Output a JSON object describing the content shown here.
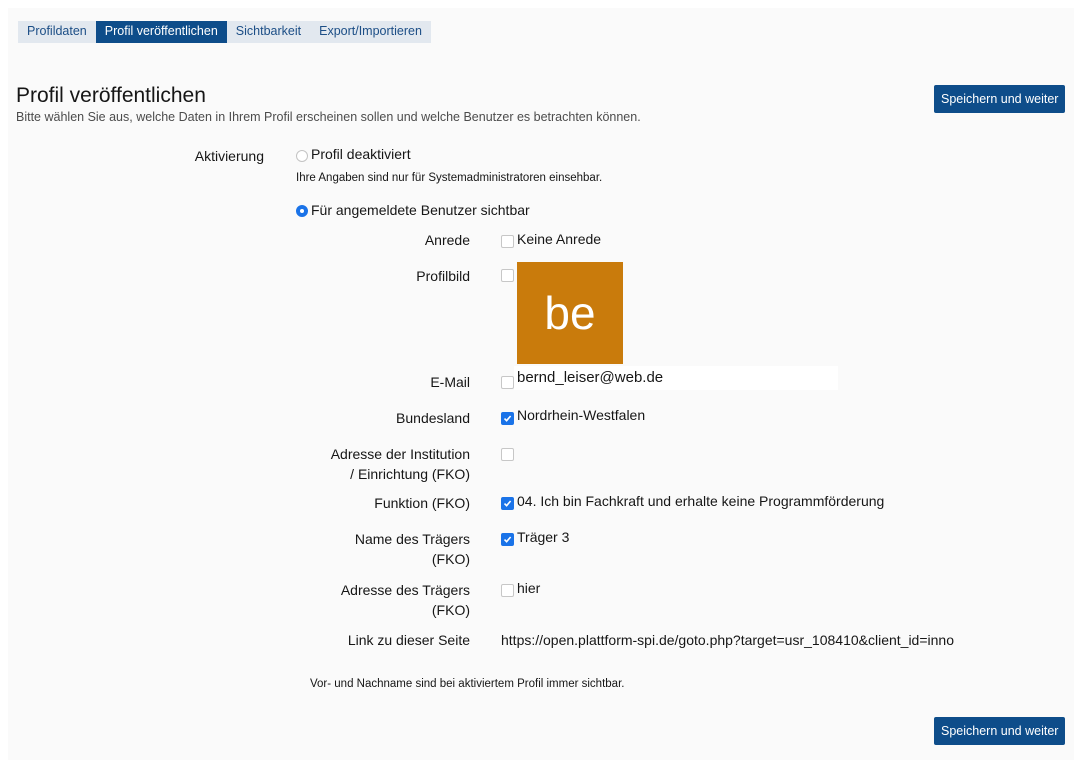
{
  "tabs": [
    {
      "label": "Profildaten",
      "active": false
    },
    {
      "label": "Profil veröffentlichen",
      "active": true
    },
    {
      "label": "Sichtbarkeit",
      "active": false
    },
    {
      "label": "Export/Importieren",
      "active": false
    }
  ],
  "header": {
    "title": "Profil veröffentlichen",
    "description": "Bitte wählen Sie aus, welche Daten in Ihrem Profil erscheinen sollen und welche Benutzer es betrachten können.",
    "save_label": "Speichern und weiter"
  },
  "activation": {
    "label": "Aktivierung",
    "option_off": {
      "label": "Profil deaktiviert",
      "selected": false,
      "help": "Ihre Angaben sind nur für Systemadministratoren einsehbar."
    },
    "option_on": {
      "label": "Für angemeldete Benutzer sichtbar",
      "selected": true
    }
  },
  "fields": {
    "anrede": {
      "label": "Anrede",
      "checked": false,
      "value": "Keine Anrede"
    },
    "profilbild": {
      "label": "Profilbild",
      "checked": false,
      "avatar_text": "be",
      "avatar_color": "#c97b0c"
    },
    "email": {
      "label": "E-Mail",
      "checked": false,
      "value": "bernd_leiser@web.de"
    },
    "bundesland": {
      "label": "Bundesland",
      "checked": true,
      "value": "Nordrhein-Westfalen"
    },
    "adresse_institution": {
      "label_line1": "Adresse der Institution",
      "label_line2": "/ Einrichtung (FKO)",
      "checked": false,
      "value": ""
    },
    "funktion": {
      "label": "Funktion (FKO)",
      "checked": true,
      "value": "04. Ich bin Fachkraft und erhalte keine Programmförderung"
    },
    "name_traeger": {
      "label_line1": "Name des Trägers",
      "label_line2": "(FKO)",
      "checked": true,
      "value": "Träger 3"
    },
    "adresse_traeger": {
      "label_line1": "Adresse des Trägers",
      "label_line2": "(FKO)",
      "checked": false,
      "value": "hier"
    },
    "link": {
      "label": "Link zu dieser Seite",
      "value": "https://open.plattform-spi.de/goto.php?target=usr_108410&client_id=inno"
    }
  },
  "footer_note": "Vor- und Nachname sind bei aktiviertem Profil immer sichtbar.",
  "colors": {
    "accent": "#0e4d8a",
    "checkbox_on": "#1a73e8",
    "tab_bar": "#e2e8ef"
  }
}
